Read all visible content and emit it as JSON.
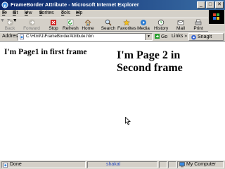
{
  "window": {
    "title": "FrameBorder Attribute - Microsoft Internet Explorer",
    "minimize_glyph": "_",
    "maximize_glyph": "□",
    "close_glyph": "✕"
  },
  "menu": {
    "items": [
      {
        "underline": "F",
        "rest": "ile"
      },
      {
        "underline": "E",
        "rest": "dit"
      },
      {
        "underline": "V",
        "rest": "iew"
      },
      {
        "pre": "F",
        "underline": "a",
        "rest": "vorites"
      },
      {
        "underline": "T",
        "rest": "ools"
      },
      {
        "underline": "H",
        "rest": "elp"
      }
    ]
  },
  "toolbar": {
    "back": "Back",
    "forward": "Forward",
    "stop": "Stop",
    "refresh": "Refresh",
    "home": "Home",
    "search": "Search",
    "favorites": "Favorites",
    "media": "Media",
    "history": "History",
    "mail": "Mail",
    "print": "Print"
  },
  "address": {
    "label": "Address",
    "url": "C:\\Html\\1\\FrameBorderAttribute.htm",
    "go": "Go",
    "links": "Links",
    "links_arrow": "»",
    "snagit": "SnagIt"
  },
  "frames": {
    "frame1_text": "I'm Page1 in first frame",
    "frame2_text": "I'm Page 2 in Second frame"
  },
  "status": {
    "text": "Done",
    "middle": "shakal",
    "zone": "My Computer"
  },
  "colors": {
    "titlebar_start": "#0a246a",
    "titlebar_end": "#3a6ea5",
    "chrome": "#d4d0c8",
    "content_bg": "#ffffff"
  }
}
